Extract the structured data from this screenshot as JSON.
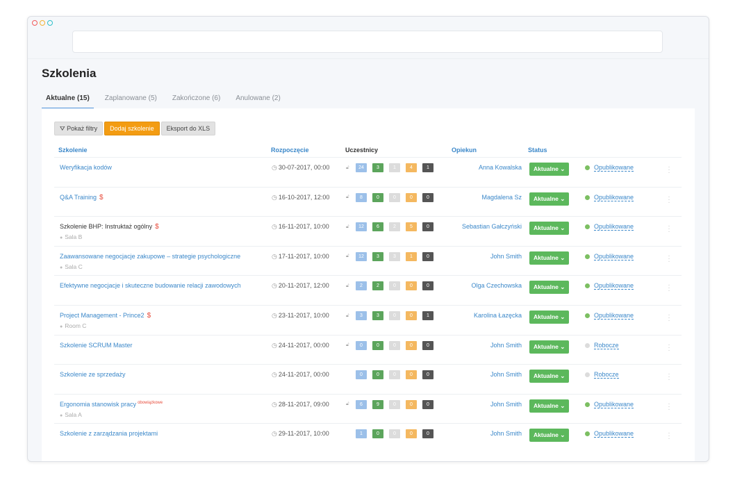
{
  "page": {
    "title": "Szkolenia"
  },
  "tabs": [
    "Aktualne (15)",
    "Zaplanowane (5)",
    "Zakończone (6)",
    "Anulowane (2)"
  ],
  "toolbar": {
    "filters": "Pokaż filtry",
    "add": "Dodaj szkolenie",
    "export": "Eksport do XLS"
  },
  "headers": {
    "training": "Szkolenie",
    "start": "Rozpoczęcie",
    "participants": "Uczestnicy",
    "supervisor": "Opiekun",
    "status": "Status"
  },
  "rows": [
    {
      "name": "Weryfikacja kodów",
      "date": "30-07-2017, 00:00",
      "badges": [
        "24",
        "3",
        "1",
        "4",
        "1"
      ],
      "opiekun": "Anna Kowalska",
      "status": "Aktualne",
      "pub": "Opublikowane"
    },
    {
      "name": "Q&A Training",
      "dollar": "$",
      "date": "16-10-2017, 12:00",
      "badges": [
        "8",
        "0",
        "0",
        "0",
        "0"
      ],
      "opiekun": "Magdalena Sz",
      "status": "Aktualne",
      "pub": "Opublikowane"
    },
    {
      "name": "Szkolenie BHP: Instruktaż ogólny",
      "dollar": "$",
      "room": "Sala B",
      "date": "16-11-2017, 10:00",
      "badges": [
        "12",
        "6",
        "2",
        "5",
        "0"
      ],
      "opiekun": "Sebastian Gałczyński",
      "status": "Aktualne",
      "pub": "Opublikowane"
    },
    {
      "name": "Zaawansowane negocjacje zakupowe – strategie psychologiczne",
      "room": "Sala C",
      "date": "17-11-2017, 10:00",
      "badges": [
        "12",
        "3",
        "3",
        "1",
        "0"
      ],
      "opiekun": "John Smith",
      "status": "Aktualne",
      "pub": "Opublikowane"
    },
    {
      "name": "Efektywne negocjacje i skuteczne budowanie relacji zawodowych",
      "date": "20-11-2017, 12:00",
      "badges": [
        "2",
        "2",
        "0",
        "0",
        "0"
      ],
      "opiekun": "Olga Czechowska",
      "status": "Aktualne",
      "pub": "Opublikowane"
    },
    {
      "name": "Project Management - Prince2",
      "dollar": "$",
      "room": "Room C",
      "date": "23-11-2017, 10:00",
      "badges": [
        "3",
        "3",
        "0",
        "0",
        "1"
      ],
      "opiekun": "Karolina Łazęcka",
      "status": "Aktualne",
      "pub": "Opublikowane"
    },
    {
      "name": "Szkolenie SCRUM Master",
      "date": "24-11-2017, 00:00",
      "badges": [
        "0",
        "0",
        "0",
        "0",
        "0"
      ],
      "opiekun": "John Smith",
      "status": "Aktualne",
      "pub": "Robocze"
    },
    {
      "name": "Szkolenie ze sprzedaży",
      "date": "24-11-2017, 00:00",
      "badges": [
        "0",
        "0",
        "0",
        "0",
        "0"
      ],
      "opiekun": "John Smith",
      "status": "Aktualne",
      "pub": "Robocze"
    },
    {
      "name": "Ergonomia stanowisk pracy",
      "sup": "obowiązkowe",
      "room": "Sala A",
      "date": "28-11-2017, 09:00",
      "badges": [
        "6",
        "9",
        "0",
        "0",
        "0"
      ],
      "opiekun": "John Smith",
      "status": "Aktualne",
      "pub": "Opublikowane"
    },
    {
      "name": "Szkolenie z zarządzania projektami",
      "date": "29-11-2017, 10:00",
      "badges": [
        "1",
        "0",
        "0",
        "0",
        "0"
      ],
      "opiekun": "John Smith",
      "status": "Aktualne",
      "pub": "Opublikowane"
    }
  ],
  "colors": {
    "accent": "#3a87c9",
    "orange": "#f39c12",
    "green": "#5cb85c"
  }
}
